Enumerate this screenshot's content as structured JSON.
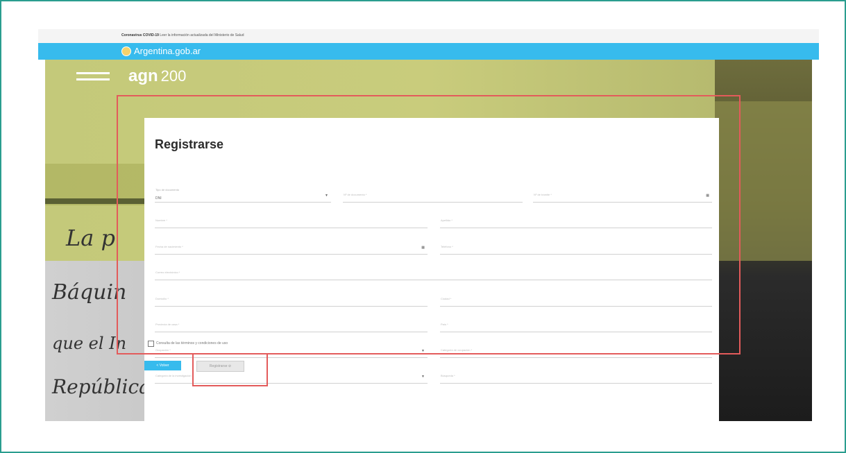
{
  "banner": {
    "bold": "Coronavirus COVID-19",
    "text": "Leer la información actualizada del Ministerio de Salud"
  },
  "gov_bar": {
    "logo": "Argentina.gob.ar"
  },
  "site": {
    "brand": "agn",
    "brand_suffix": "200"
  },
  "background_script": {
    "line1": "La p",
    "line2": "Báquin",
    "line3": "que el In",
    "line4": "República"
  },
  "form": {
    "title": "Registrarse",
    "doc_type": {
      "label": "Tipo de documento",
      "value": "DNI"
    },
    "doc_number": "Nº de documento *",
    "doc_procedure": "Nº de trámite *",
    "name": "Nombre *",
    "lastname": "Apellido *",
    "birthdate": "Fecha de nacimiento *",
    "phone": "Teléfono *",
    "email": "Correo electrónico *",
    "address": "Domicilio *",
    "city": "Ciudad *",
    "province": "Provincia de casa *",
    "country": "País *",
    "occupation": "Ocupación *",
    "occupation_category": "Categoría de ocupación *",
    "research_category": "Categoría de la investigación *",
    "research": "Búsqueda *",
    "terms": "Consulta de las términos y condiciones de uso",
    "back_button": "< Volver",
    "register_button": "Registrarse ⊘"
  },
  "colors": {
    "accent": "#37bbed",
    "highlight": "#e35b5b",
    "frame": "#2a9d8f"
  }
}
